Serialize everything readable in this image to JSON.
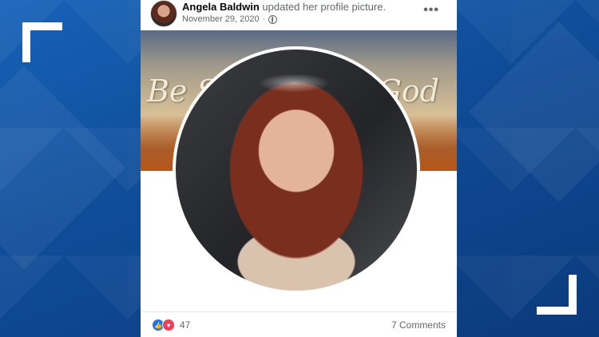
{
  "post": {
    "author": "Angela Baldwin",
    "action": "updated her profile picture.",
    "date": "November 29, 2020",
    "privacy_icon": "globe-icon",
    "more_icon": "more-options-icon"
  },
  "cover": {
    "text_left": "Be S",
    "text_right": "God"
  },
  "footer": {
    "reaction_icons": [
      "like-icon",
      "love-icon"
    ],
    "reaction_count": "47",
    "comments": "7 Comments"
  },
  "colors": {
    "background_blue": "#0f4c98",
    "facebook_blue": "#1877f2",
    "love_red": "#f33e58"
  }
}
